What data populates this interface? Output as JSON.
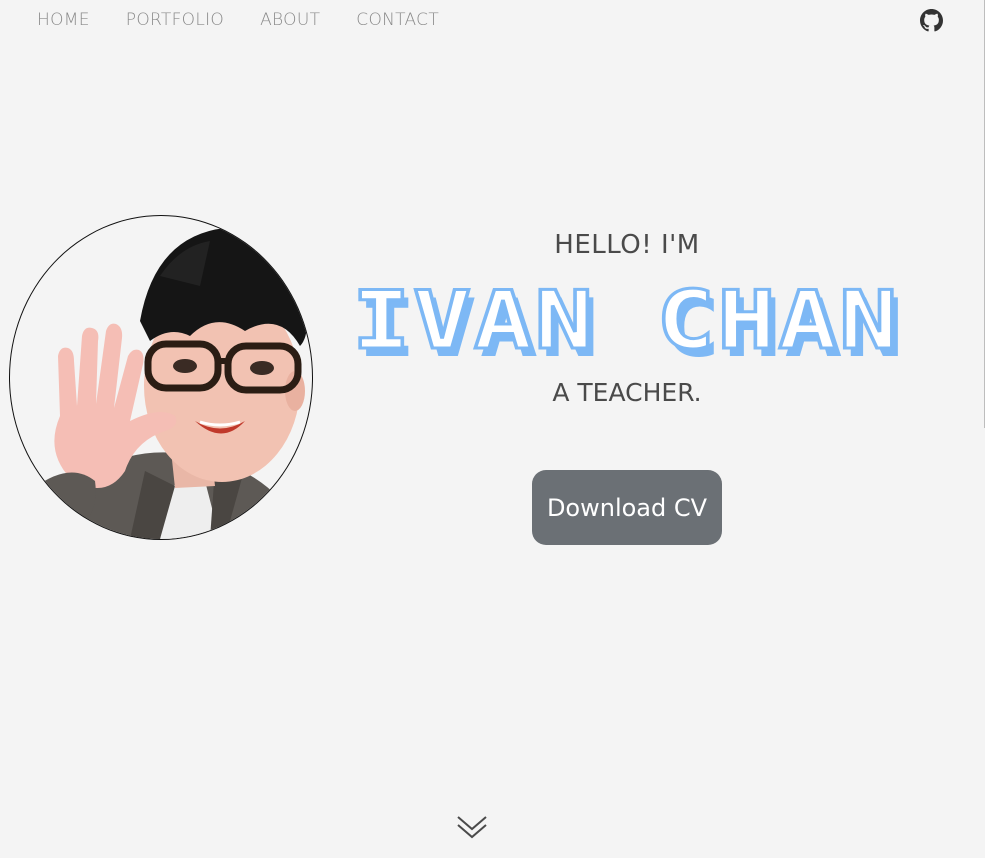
{
  "nav": {
    "items": [
      {
        "label": "HOME"
      },
      {
        "label": "PORTFOLIO"
      },
      {
        "label": "ABOUT"
      },
      {
        "label": "CONTACT"
      }
    ],
    "github_icon": "github-icon"
  },
  "hero": {
    "greeting": "HELLO! I'M",
    "name": "IVAN CHAN",
    "subtitle": "A TEACHER.",
    "cv_button": "Download CV",
    "scroll_icon": "double-chevron-down-icon"
  },
  "colors": {
    "background": "#f4f4f4",
    "name_fill": "#ffffff",
    "name_outline": "#7db8f5",
    "button_bg": "#6b7075",
    "nav_text": "#8a8a8a"
  }
}
